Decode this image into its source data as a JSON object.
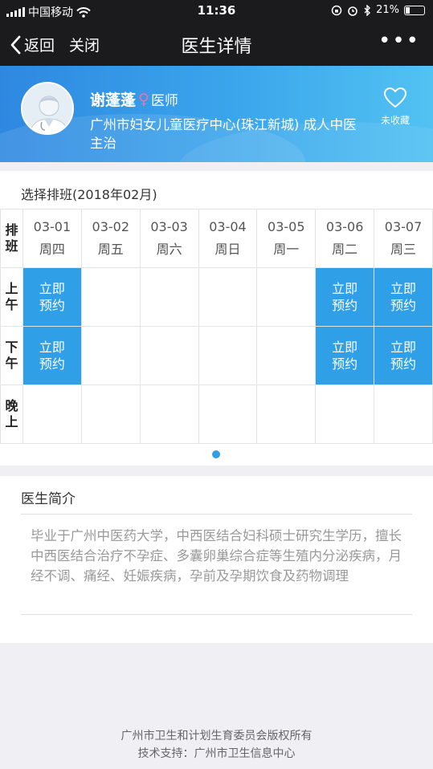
{
  "status": {
    "carrier": "中国移动",
    "time": "11:36",
    "battery_percent": "21%"
  },
  "nav": {
    "back_label": "返回",
    "close_label": "关闭",
    "title": "医生详情",
    "more_label": "•••"
  },
  "doctor": {
    "name": "谢蓬蓬",
    "gender_symbol": "♀",
    "title": "医师",
    "hospital": "广州市妇女儿童医疗中心(珠江新城)  成人中医主治",
    "favorite_label": "未收藏"
  },
  "schedule": {
    "title": "选择排班(2018年02月)",
    "corner_label": "排班",
    "days": [
      {
        "date": "03-01",
        "weekday": "周四"
      },
      {
        "date": "03-02",
        "weekday": "周五"
      },
      {
        "date": "03-03",
        "weekday": "周六"
      },
      {
        "date": "03-04",
        "weekday": "周日"
      },
      {
        "date": "03-05",
        "weekday": "周一"
      },
      {
        "date": "03-06",
        "weekday": "周二"
      },
      {
        "date": "03-07",
        "weekday": "周三"
      }
    ],
    "rows": [
      {
        "label": "上午",
        "slots": [
          "立即预约",
          "",
          "",
          "",
          "",
          "立即预约",
          "立即预约"
        ]
      },
      {
        "label": "下午",
        "slots": [
          "立即预约",
          "",
          "",
          "",
          "",
          "立即预约",
          "立即预约"
        ]
      },
      {
        "label": "晚上",
        "slots": [
          "",
          "",
          "",
          "",
          "",
          "",
          ""
        ]
      }
    ]
  },
  "intro": {
    "title": "医生简介",
    "text": "毕业于广州中医药大学，中西医结合妇科硕士研究生学历，擅长中西医结合治疗不孕症、多囊卵巢综合症等生殖内分泌疾病，月经不调、痛经、妊娠疾病，孕前及孕期饮食及药物调理"
  },
  "footer": {
    "line1": "广州市卫生和计划生育委员会版权所有",
    "line2": "技术支持：广州市卫生信息中心"
  },
  "colors": {
    "accent": "#2f9fe8",
    "header_start": "#2e88e0",
    "header_end": "#52c2f2",
    "bar": "#1b1b1d",
    "female": "#f06fb5"
  }
}
